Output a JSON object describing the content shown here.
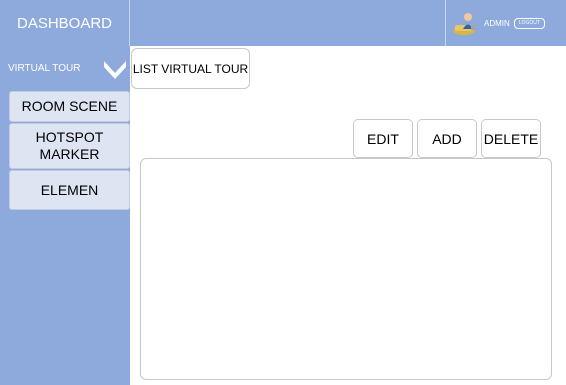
{
  "header": {
    "brand": "DASHBOARD",
    "user": {
      "icon": "admin-user-icon",
      "label": "ADMIN",
      "logout_label": "LOGOUT"
    }
  },
  "sidebar": {
    "section": {
      "label": "VIRTUAL TOUR",
      "icon": "chevron-down-icon"
    },
    "items": [
      {
        "label": "ROOM SCENE"
      },
      {
        "label": "HOTSPOT MARKER"
      },
      {
        "label": "ELEMEN"
      }
    ]
  },
  "main": {
    "tab_label": "LIST VIRTUAL TOUR",
    "toolbar": {
      "edit_label": "EDIT",
      "add_label": "ADD",
      "delete_label": "DELETE"
    }
  },
  "colors": {
    "header_bg": "#8ea9dc",
    "sidebar_bg": "#8ea9dc",
    "menu_item_bg": "#dde4f2"
  }
}
